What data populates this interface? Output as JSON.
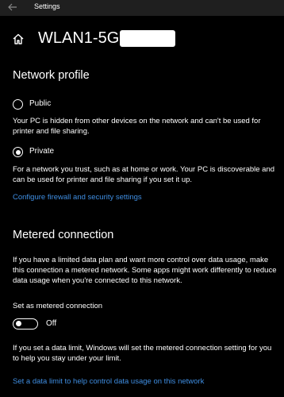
{
  "window": {
    "app_title": "Settings"
  },
  "header": {
    "title": "WLAN1-5G-"
  },
  "network_profile": {
    "heading": "Network profile",
    "options": [
      {
        "label": "Public",
        "selected": false,
        "description": "Your PC is hidden from other devices on the network and can't be used for printer and file sharing."
      },
      {
        "label": "Private",
        "selected": true,
        "description": "For a network you trust, such as at home or work. Your PC is discoverable and can be used for printer and file sharing if you set it up."
      }
    ],
    "firewall_link": "Configure firewall and security settings"
  },
  "metered": {
    "heading": "Metered connection",
    "description": "If you have a limited data plan and want more control over data usage, make this connection a metered network. Some apps might work differently to reduce data usage when you're connected to this network.",
    "toggle_label": "Set as metered connection",
    "toggle_state": "Off",
    "toggle_on": false,
    "limit_note": "If you set a data limit, Windows will set the metered connection setting for you to help you stay under your limit.",
    "limit_link": "Set a data limit to help control data usage on this network"
  },
  "colors": {
    "background": "#000000",
    "titlebar": "#1f1f1f",
    "link": "#3f8ee2",
    "text": "#ffffff"
  },
  "icons": {
    "back": "back-arrow-icon",
    "home": "home-icon"
  }
}
